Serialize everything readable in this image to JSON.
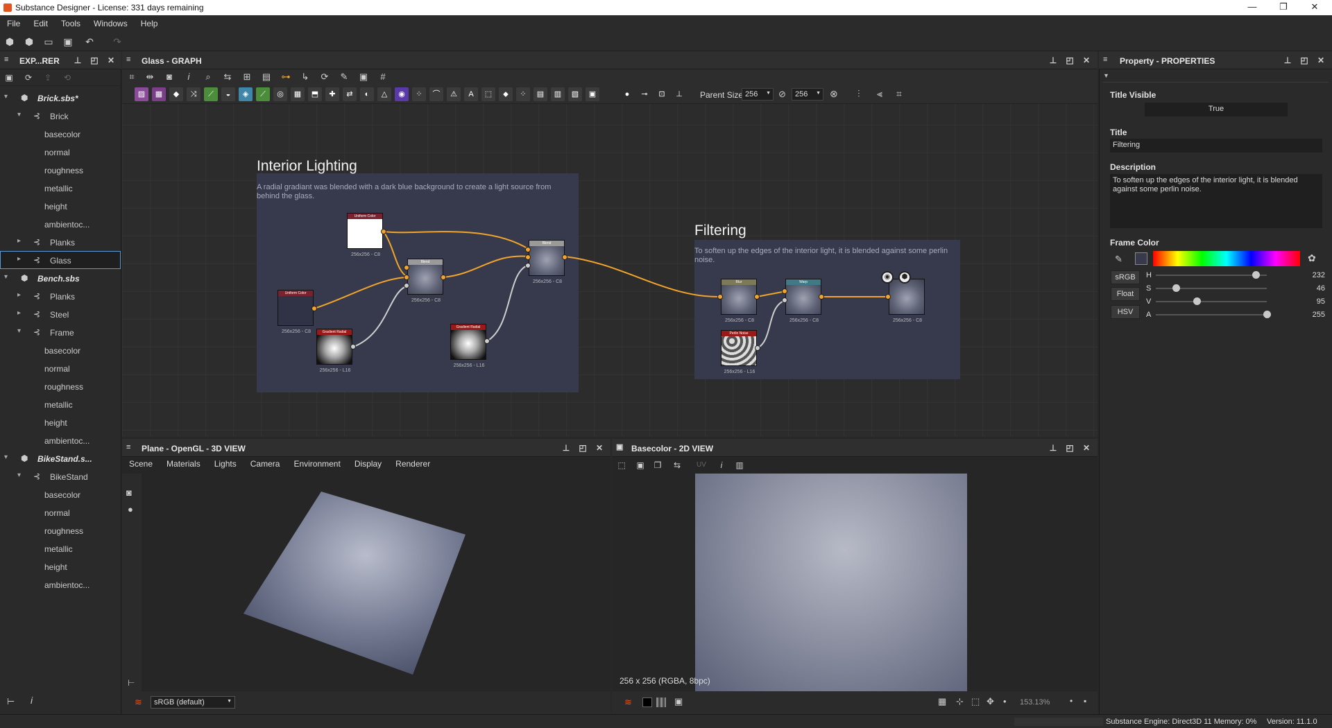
{
  "window": {
    "title": "Substance Designer - License: 331 days remaining"
  },
  "menu": [
    "File",
    "Edit",
    "Tools",
    "Windows",
    "Help"
  ],
  "explorer": {
    "title": "EXP...RER",
    "rows": [
      {
        "label": "Brick.sbs*",
        "kind": "package",
        "level": 0,
        "expanded": true
      },
      {
        "label": "Brick",
        "kind": "graph",
        "level": 1,
        "expanded": true
      },
      {
        "label": "basecolor",
        "kind": "output",
        "level": 2
      },
      {
        "label": "normal",
        "kind": "output",
        "level": 2
      },
      {
        "label": "roughness",
        "kind": "output",
        "level": 2
      },
      {
        "label": "metallic",
        "kind": "output",
        "level": 2
      },
      {
        "label": "height",
        "kind": "output",
        "level": 2
      },
      {
        "label": "ambientoc...",
        "kind": "output",
        "level": 2
      },
      {
        "label": "Planks",
        "kind": "graph",
        "level": 1,
        "expanded": false
      },
      {
        "label": "Glass",
        "kind": "graph",
        "level": 1,
        "expanded": false,
        "selected": true
      },
      {
        "label": "Bench.sbs",
        "kind": "package",
        "level": 0,
        "expanded": true
      },
      {
        "label": "Planks",
        "kind": "graph",
        "level": 1,
        "expanded": false
      },
      {
        "label": "Steel",
        "kind": "graph",
        "level": 1,
        "expanded": false
      },
      {
        "label": "Frame",
        "kind": "graph",
        "level": 1,
        "expanded": true
      },
      {
        "label": "basecolor",
        "kind": "output",
        "level": 2
      },
      {
        "label": "normal",
        "kind": "output",
        "level": 2
      },
      {
        "label": "roughness",
        "kind": "output",
        "level": 2
      },
      {
        "label": "metallic",
        "kind": "output",
        "level": 2
      },
      {
        "label": "height",
        "kind": "output",
        "level": 2
      },
      {
        "label": "ambientoc...",
        "kind": "output",
        "level": 2
      },
      {
        "label": "BikeStand.s...",
        "kind": "package",
        "level": 0,
        "expanded": true
      },
      {
        "label": "BikeStand",
        "kind": "graph",
        "level": 1,
        "expanded": true
      },
      {
        "label": "basecolor",
        "kind": "output",
        "level": 2
      },
      {
        "label": "normal",
        "kind": "output",
        "level": 2
      },
      {
        "label": "roughness",
        "kind": "output",
        "level": 2
      },
      {
        "label": "metallic",
        "kind": "output",
        "level": 2
      },
      {
        "label": "height",
        "kind": "output",
        "level": 2
      },
      {
        "label": "ambientoc...",
        "kind": "output",
        "level": 2
      }
    ]
  },
  "graph": {
    "title": "Glass - GRAPH",
    "parent_size_label": "Parent Size:",
    "parent_size": "256",
    "size_value": "256",
    "frames": {
      "interior": {
        "title": "Interior Lighting",
        "description": "A radial gradiant was blended with a dark blue background to create a light source from behind the glass."
      },
      "filtering": {
        "title": "Filtering",
        "description": "To soften up the edges of the interior light, it is blended against some perlin noise."
      }
    },
    "nodes": [
      {
        "id": "uc1",
        "header": "Uniform Color",
        "label": "256x256 - C8",
        "header_color": "#7a2230",
        "thumb": "white"
      },
      {
        "id": "uc2",
        "header": "Uniform Color",
        "label": "256x256 - C8",
        "header_color": "#7a2230",
        "thumb": "dark"
      },
      {
        "id": "gr1",
        "header": "Gradient Radial",
        "label": "256x256 - L16",
        "header_color": "#9a1a1a",
        "thumb": "radial"
      },
      {
        "id": "bl1",
        "header": "Blend",
        "label": "256x256 - C8",
        "header_color": "#9a9a9a",
        "thumb": "blend"
      },
      {
        "id": "gr2",
        "header": "Gradient Radial",
        "label": "256x256 - L16",
        "header_color": "#9a1a1a",
        "thumb": "radial"
      },
      {
        "id": "bl2",
        "header": "Blend",
        "label": "256x256 - C8",
        "header_color": "#9a9a9a",
        "thumb": "blend"
      },
      {
        "id": "blur",
        "header": "Blur",
        "label": "256x256 - C8",
        "header_color": "#7d7a5a",
        "thumb": "blend"
      },
      {
        "id": "warp",
        "header": "Warp",
        "label": "256x256 - C8",
        "header_color": "#3f7a86",
        "thumb": "blend"
      },
      {
        "id": "perlin",
        "header": "Perlin Noise",
        "label": "256x256 - L16",
        "header_color": "#9a1a1a",
        "thumb": "noise"
      },
      {
        "id": "out",
        "header": "",
        "label": "256x256 - C8",
        "header_color": "#4a4a4a",
        "thumb": "blend"
      }
    ]
  },
  "properties": {
    "title": "Property - PROPERTIES",
    "title_visible_label": "Title Visible",
    "title_visible_value": "True",
    "title_label": "Title",
    "title_value": "Filtering",
    "description_label": "Description",
    "description_value": "To soften up the edges of the interior light, it is blended against some perlin noise.",
    "frame_color_label": "Frame Color",
    "modes": [
      "sRGB",
      "Float",
      "HSV"
    ],
    "sliders": [
      {
        "name": "H",
        "value": "232",
        "fraction": 0.9
      },
      {
        "name": "S",
        "value": "46",
        "fraction": 0.18
      },
      {
        "name": "V",
        "value": "95",
        "fraction": 0.37
      },
      {
        "name": "A",
        "value": "255",
        "fraction": 1.0
      }
    ]
  },
  "view3d": {
    "title": "Plane - OpenGL - 3D VIEW",
    "menu": [
      "Scene",
      "Materials",
      "Lights",
      "Camera",
      "Environment",
      "Display",
      "Renderer"
    ],
    "colorspace": "sRGB (default)"
  },
  "view2d": {
    "title": "Basecolor - 2D VIEW",
    "uv_label": "UV",
    "info": "256 x 256 (RGBA, 8bpc)",
    "zoom": "153.13%"
  },
  "status": {
    "engine": "Substance Engine: Direct3D 11  Memory: 0%",
    "version": "Version: 11.1.0"
  },
  "colors": {
    "accent": "#f2a52a",
    "frame": "#363a4c",
    "selection": "#5b9bd5"
  }
}
